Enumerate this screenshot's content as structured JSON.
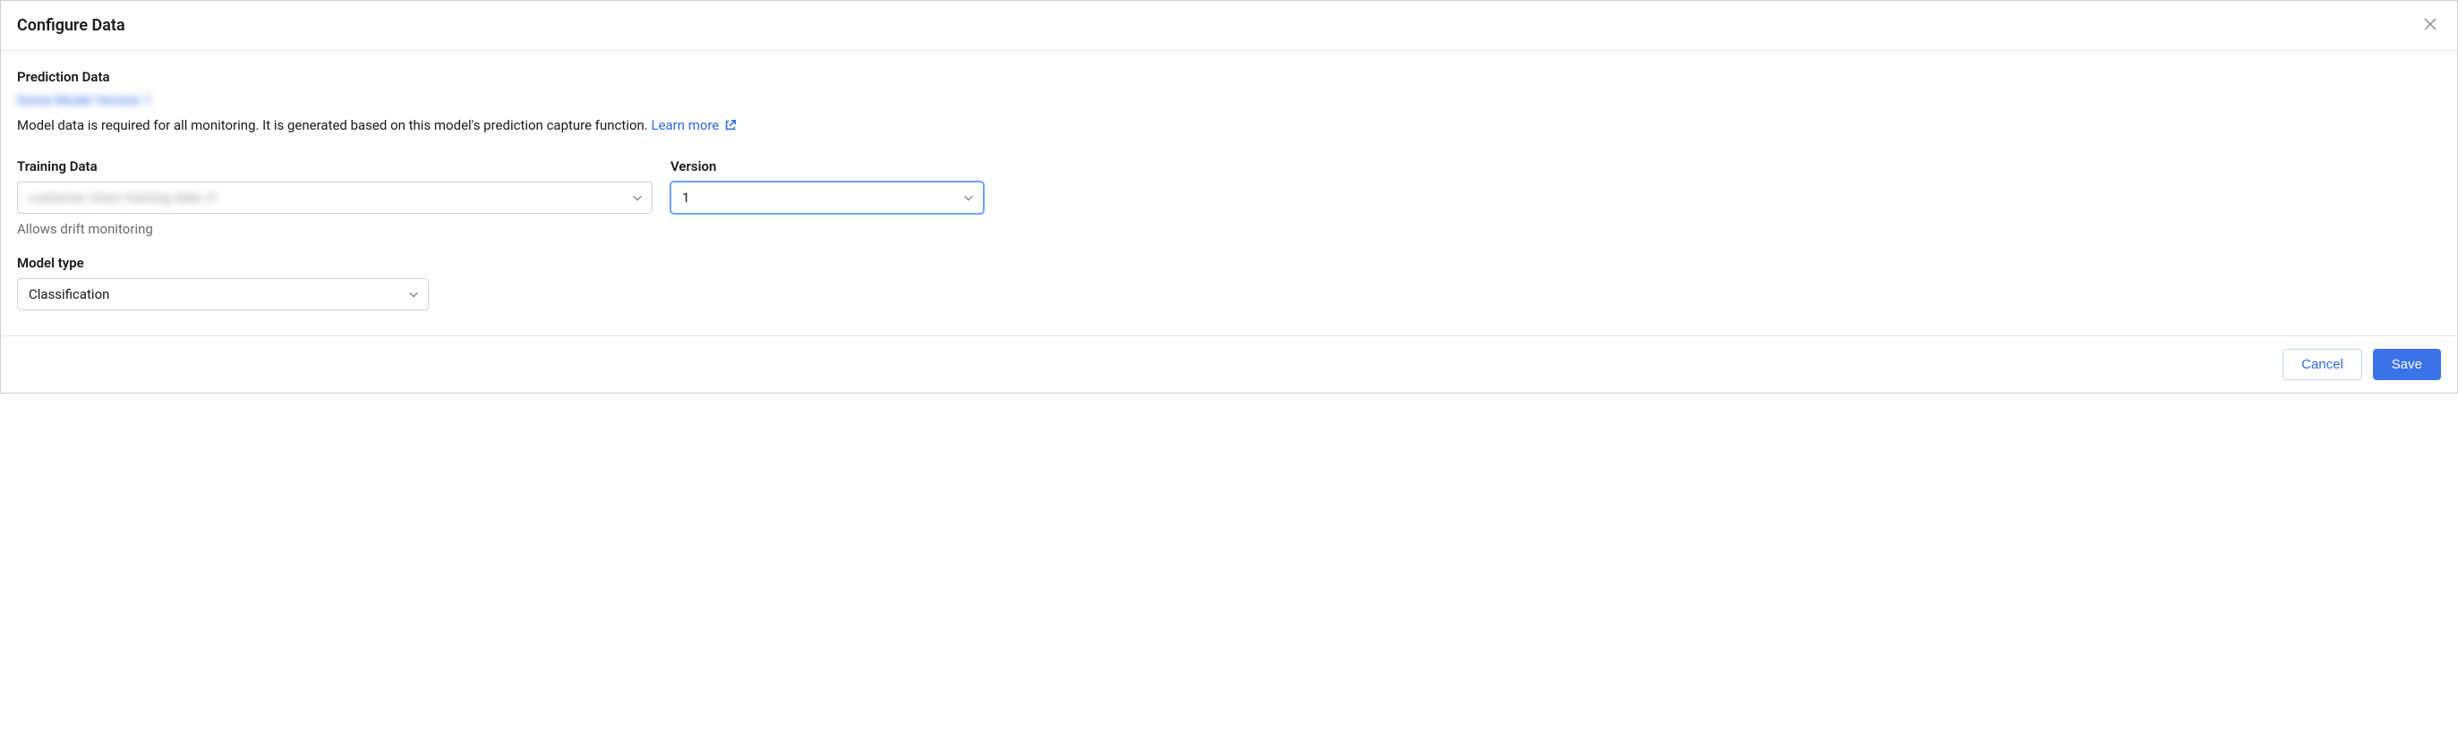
{
  "header": {
    "title": "Configure Data"
  },
  "prediction": {
    "heading": "Prediction Data",
    "blurred_link_text": "Some Model Version 1",
    "description_prefix": "Model data is required for all monitoring. It is generated based on this model's prediction capture function. ",
    "learn_more_label": "Learn more"
  },
  "training": {
    "label": "Training Data",
    "value_blurred": "customer churn training data v1",
    "helper": "Allows drift monitoring"
  },
  "version": {
    "label": "Version",
    "value": "1"
  },
  "model_type": {
    "label": "Model type",
    "value": "Classification"
  },
  "footer": {
    "cancel_label": "Cancel",
    "save_label": "Save"
  }
}
